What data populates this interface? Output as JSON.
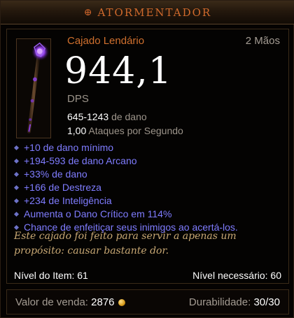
{
  "header": {
    "icon": "cross-circle-icon",
    "title": "ATORMENTADOR"
  },
  "item": {
    "type": "Cajado Lendário",
    "hands": "2 Mãos",
    "dps_value": "944,1",
    "dps_label": "DPS",
    "damage_range": "645-1243",
    "damage_label": "de dano",
    "attack_speed": "1,00",
    "attack_speed_label": "Ataques por Segundo"
  },
  "affixes": [
    "+10 de dano mínimo",
    "+194-593 de dano Arcano",
    "+33% de dano",
    "+166 de Destreza",
    "+234 de Inteligência",
    "Aumenta o Dano Crítico em 114%",
    "Chance de enfeitiçar seus inimigos ao acertá-los."
  ],
  "flavor_lines": [
    "Este cajado foi feito para servir a apenas um",
    "propósito: causar bastante dor."
  ],
  "item_level": "Nível do Item: 61",
  "required_level": "Nível necessário: 60",
  "sell": {
    "label": "Valor de venda:",
    "value": "2876",
    "icon": "gold-coin-icon"
  },
  "durability": {
    "label": "Durabilidade:",
    "value": "30/30"
  },
  "colors": {
    "header_text": "#d06a2c",
    "item_type": "#d0702e",
    "affix": "#7f7cff",
    "flavor": "#c8a874"
  }
}
